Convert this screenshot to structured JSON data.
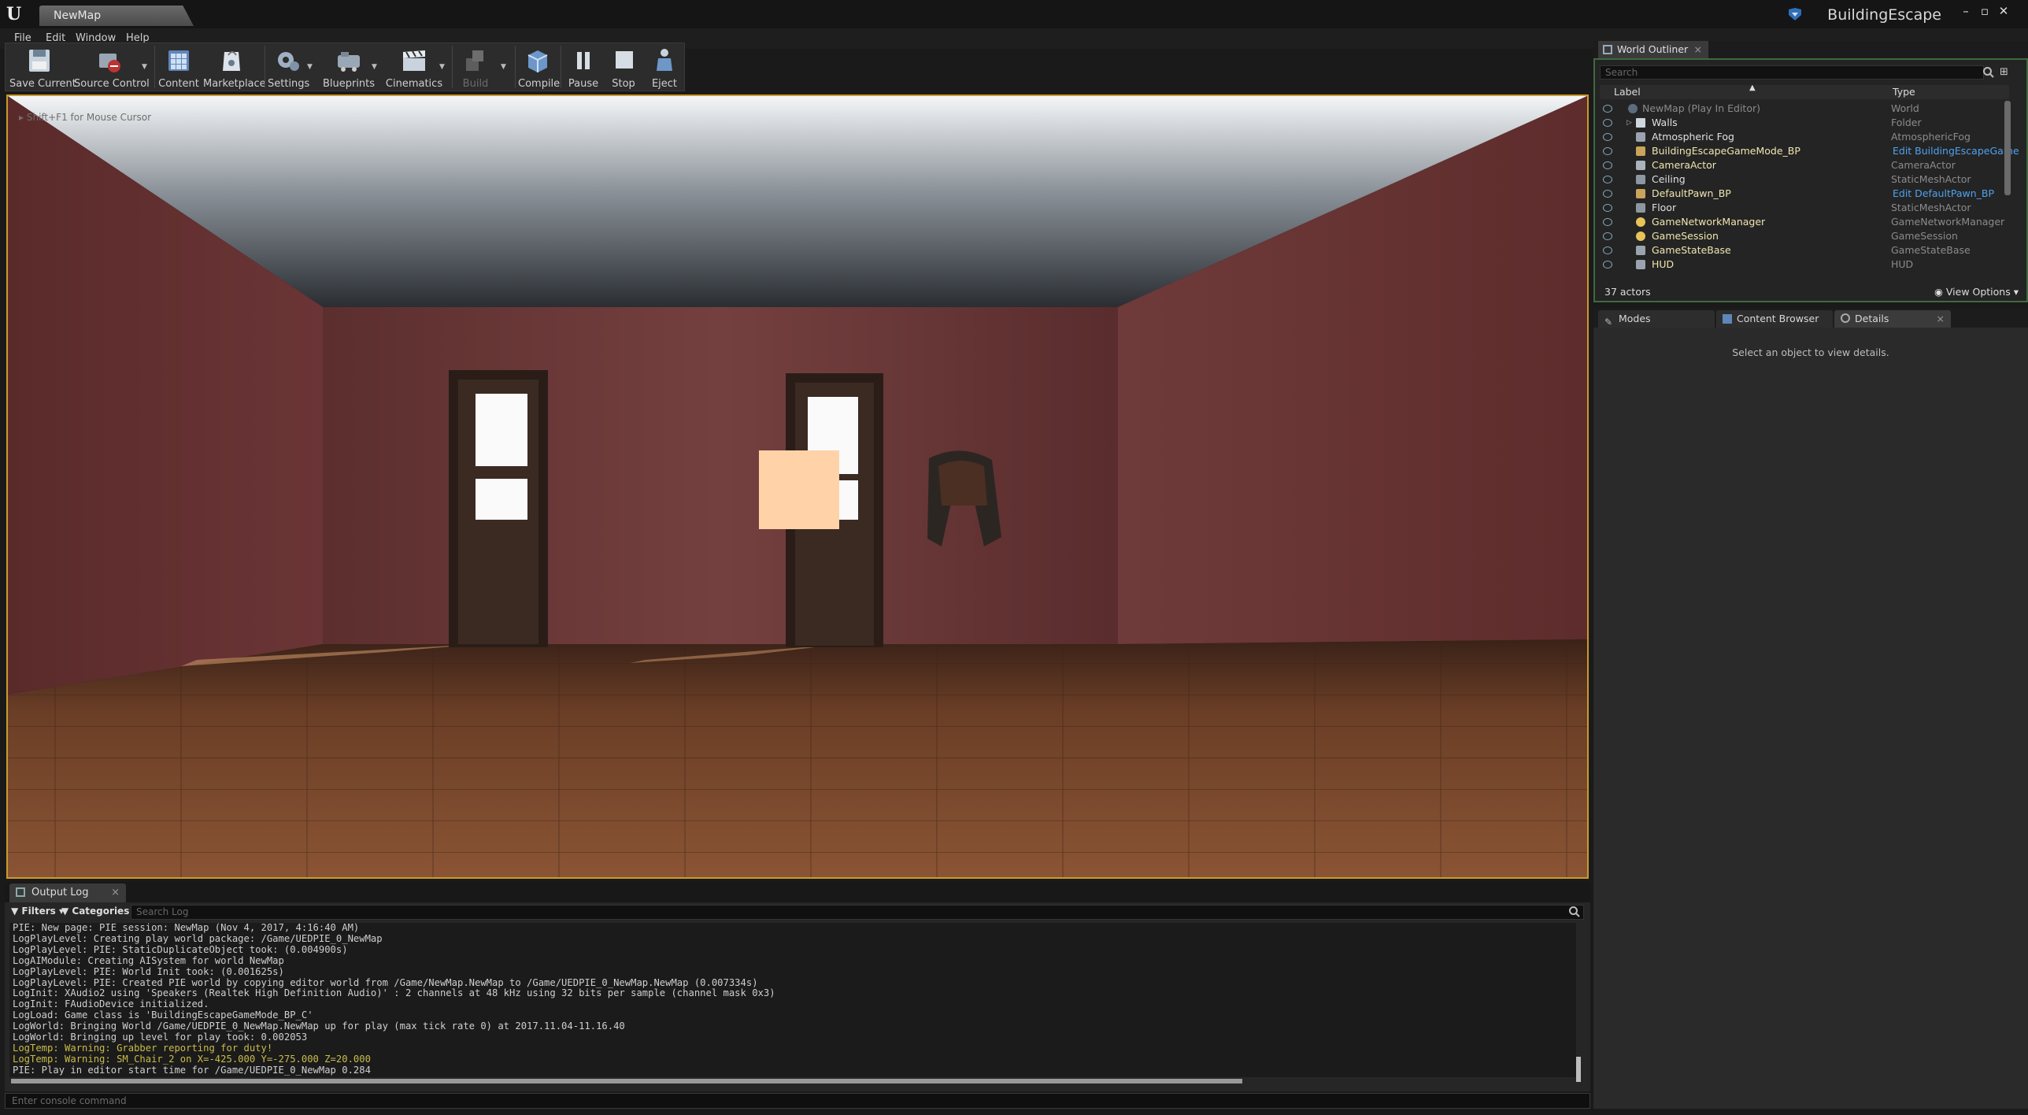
{
  "window": {
    "doc_tab": "NewMap",
    "project_name": "BuildingEscape",
    "controls": [
      "–",
      "▫",
      "✕"
    ]
  },
  "menu": [
    "File",
    "Edit",
    "Window",
    "Help"
  ],
  "toolbar": {
    "buttons": [
      {
        "label": "Save Current",
        "icon": "save-icon"
      },
      {
        "label": "Source Control",
        "icon": "source-control-icon"
      },
      {
        "label": "Content",
        "icon": "content-icon"
      },
      {
        "label": "Marketplace",
        "icon": "marketplace-icon"
      },
      {
        "label": "Settings",
        "icon": "settings-icon"
      },
      {
        "label": "Blueprints",
        "icon": "blueprints-icon"
      },
      {
        "label": "Cinematics",
        "icon": "cinematics-icon"
      },
      {
        "label": "Build",
        "icon": "build-icon"
      },
      {
        "label": "Compile",
        "icon": "compile-icon"
      },
      {
        "label": "Pause",
        "icon": "pause-icon"
      },
      {
        "label": "Stop",
        "icon": "stop-icon"
      },
      {
        "label": "Eject",
        "icon": "eject-icon"
      }
    ]
  },
  "viewport": {
    "hint": "Shift+F1 for Mouse Cursor"
  },
  "output_log": {
    "tab_label": "Output Log",
    "filters_label": "Filters",
    "categories_label": "Categories",
    "search_placeholder": "Search Log",
    "lines": [
      {
        "text": "PIE: New page: PIE session: NewMap (Nov 4, 2017, 4:16:40 AM)",
        "warn": false
      },
      {
        "text": "LogPlayLevel: Creating play world package: /Game/UEDPIE_0_NewMap",
        "warn": false
      },
      {
        "text": "LogPlayLevel: PIE: StaticDuplicateObject took: (0.004900s)",
        "warn": false
      },
      {
        "text": "LogAIModule: Creating AISystem for world NewMap",
        "warn": false
      },
      {
        "text": "LogPlayLevel: PIE: World Init took: (0.001625s)",
        "warn": false
      },
      {
        "text": "LogPlayLevel: PIE: Created PIE world by copying editor world from /Game/NewMap.NewMap to /Game/UEDPIE_0_NewMap.NewMap (0.007334s)",
        "warn": false
      },
      {
        "text": "LogInit: XAudio2 using 'Speakers (Realtek High Definition Audio)' : 2 channels at 48 kHz using 32 bits per sample (channel mask 0x3)",
        "warn": false
      },
      {
        "text": "LogInit: FAudioDevice initialized.",
        "warn": false
      },
      {
        "text": "LogLoad: Game class is 'BuildingEscapeGameMode_BP_C'",
        "warn": false
      },
      {
        "text": "LogWorld: Bringing World /Game/UEDPIE_0_NewMap.NewMap up for play (max tick rate 0) at 2017.11.04-11.16.40",
        "warn": false
      },
      {
        "text": "LogWorld: Bringing up level for play took: 0.002053",
        "warn": false
      },
      {
        "text": "LogTemp: Warning: Grabber reporting for duty!",
        "warn": true
      },
      {
        "text": "LogTemp: Warning: SM_Chair_2 on X=-425.000 Y=-275.000 Z=20.000",
        "warn": true
      },
      {
        "text": "PIE: Play in editor start time for /Game/UEDPIE_0_NewMap 0.284",
        "warn": false
      }
    ],
    "console_placeholder": "Enter console command"
  },
  "world_outliner": {
    "tab_label": "World Outliner",
    "search_placeholder": "Search",
    "col_label": "Label",
    "col_type": "Type",
    "rows": [
      {
        "label": "NewMap (Play In Editor)",
        "type": "World",
        "icon": "world-icon",
        "link": false,
        "dim": true
      },
      {
        "label": "Walls",
        "type": "Folder",
        "icon": "folder-icon",
        "link": false,
        "dim": false
      },
      {
        "label": "Atmospheric Fog",
        "type": "AtmosphericFog",
        "icon": "fog-icon",
        "link": false,
        "dim": false
      },
      {
        "label": "BuildingEscapeGameMode_BP",
        "type": "Edit BuildingEscapeGame",
        "icon": "blueprint-icon",
        "link": true,
        "dim": false
      },
      {
        "label": "CameraActor",
        "type": "CameraActor",
        "icon": "camera-icon",
        "link": false,
        "dim": false
      },
      {
        "label": "Ceiling",
        "type": "StaticMeshActor",
        "icon": "mesh-icon",
        "link": false,
        "dim": false
      },
      {
        "label": "DefaultPawn_BP",
        "type": "Edit DefaultPawn_BP",
        "icon": "blueprint-icon",
        "link": true,
        "dim": false
      },
      {
        "label": "Floor",
        "type": "StaticMeshActor",
        "icon": "mesh-icon",
        "link": false,
        "dim": false
      },
      {
        "label": "GameNetworkManager",
        "type": "GameNetworkManager",
        "icon": "actor-icon",
        "link": false,
        "dim": false
      },
      {
        "label": "GameSession",
        "type": "GameSession",
        "icon": "actor-icon",
        "link": false,
        "dim": false
      },
      {
        "label": "GameStateBase",
        "type": "GameStateBase",
        "icon": "actor-icon",
        "link": false,
        "dim": false
      },
      {
        "label": "HUD",
        "type": "HUD",
        "icon": "hud-icon",
        "link": false,
        "dim": false
      }
    ],
    "actor_count": "37 actors",
    "view_options": "View Options"
  },
  "side_tabs": [
    "Modes",
    "Content Browser",
    "Details"
  ],
  "details": {
    "empty_message": "Select an object to view details."
  },
  "colors": {
    "accent_border": "#c99a2e",
    "outliner_border": "#3e6a3e",
    "link": "#4fa2ee",
    "warning": "#c9bc4a"
  }
}
